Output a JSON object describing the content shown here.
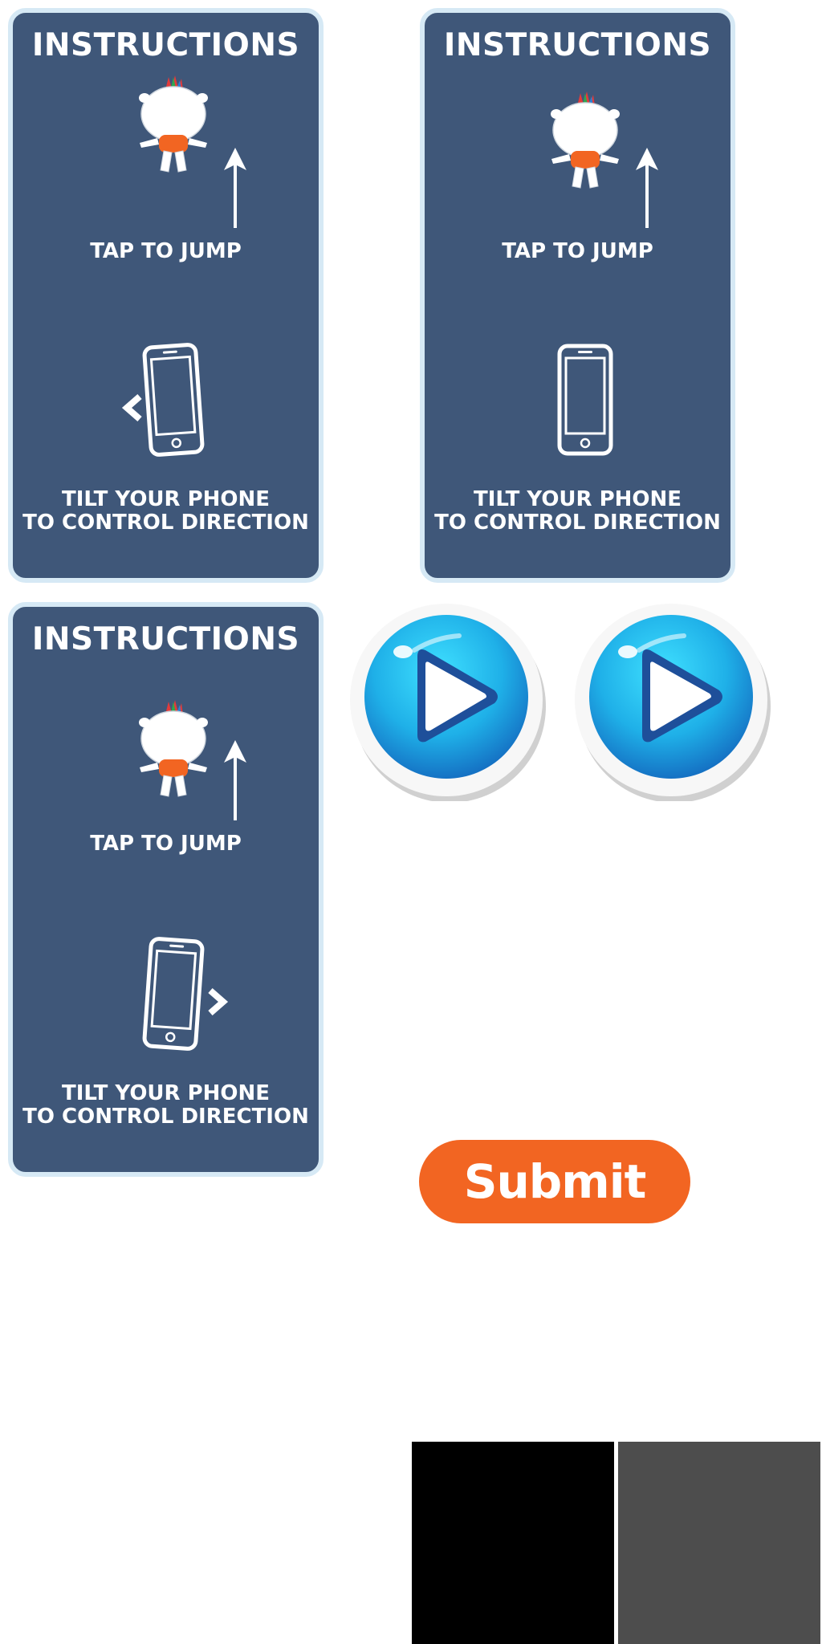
{
  "cards": [
    {
      "title": "INSTRUCTIONS",
      "tap_label": "TAP TO JUMP",
      "tilt_line1": "TILT YOUR PHONE",
      "tilt_line2": "TO CONTROL DIRECTION",
      "direction": "left"
    },
    {
      "title": "INSTRUCTIONS",
      "tap_label": "TAP TO JUMP",
      "tilt_line1": "TILT YOUR PHONE",
      "tilt_line2": "TO CONTROL DIRECTION",
      "direction": "none"
    },
    {
      "title": "INSTRUCTIONS",
      "tap_label": "TAP TO JUMP",
      "tilt_line1": "TILT YOUR PHONE",
      "tilt_line2": "TO CONTROL DIRECTION",
      "direction": "right"
    }
  ],
  "play_buttons": [
    {
      "icon": "play-icon"
    },
    {
      "icon": "play-icon"
    }
  ],
  "submit": {
    "label": "Submit"
  },
  "colors": {
    "card_bg": "#3f5779",
    "card_border": "#d6e9f5",
    "play_blue": "#1fb8e6",
    "submit_orange": "#f26522",
    "swatch_black": "#000000",
    "swatch_gray": "#4d4d4d"
  },
  "swatches": [
    {
      "color": "#000000"
    },
    {
      "color": "#4d4d4d"
    }
  ]
}
